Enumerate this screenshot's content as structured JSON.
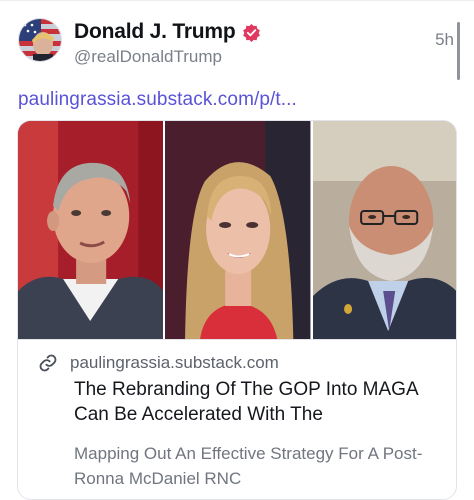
{
  "post": {
    "display_name": "Donald J. Trump",
    "handle": "@realDonaldTrump",
    "timestamp": "5h",
    "link_text": "paulingrassia.substack.com/p/t..."
  },
  "card": {
    "domain": "paulingrassia.substack.com",
    "title": "The Rebranding Of The GOP Into MAGA Can Be Accelerated With The",
    "description": "Mapping Out An Effective Strategy For A Post-Ronna McDaniel RNC"
  },
  "icons": {
    "verified": "verified-badge-icon",
    "link": "link-chain-icon"
  },
  "colors": {
    "accent_link": "#5a52d6",
    "verified_badge": "#e0395f",
    "muted_text": "#7a7f89"
  }
}
